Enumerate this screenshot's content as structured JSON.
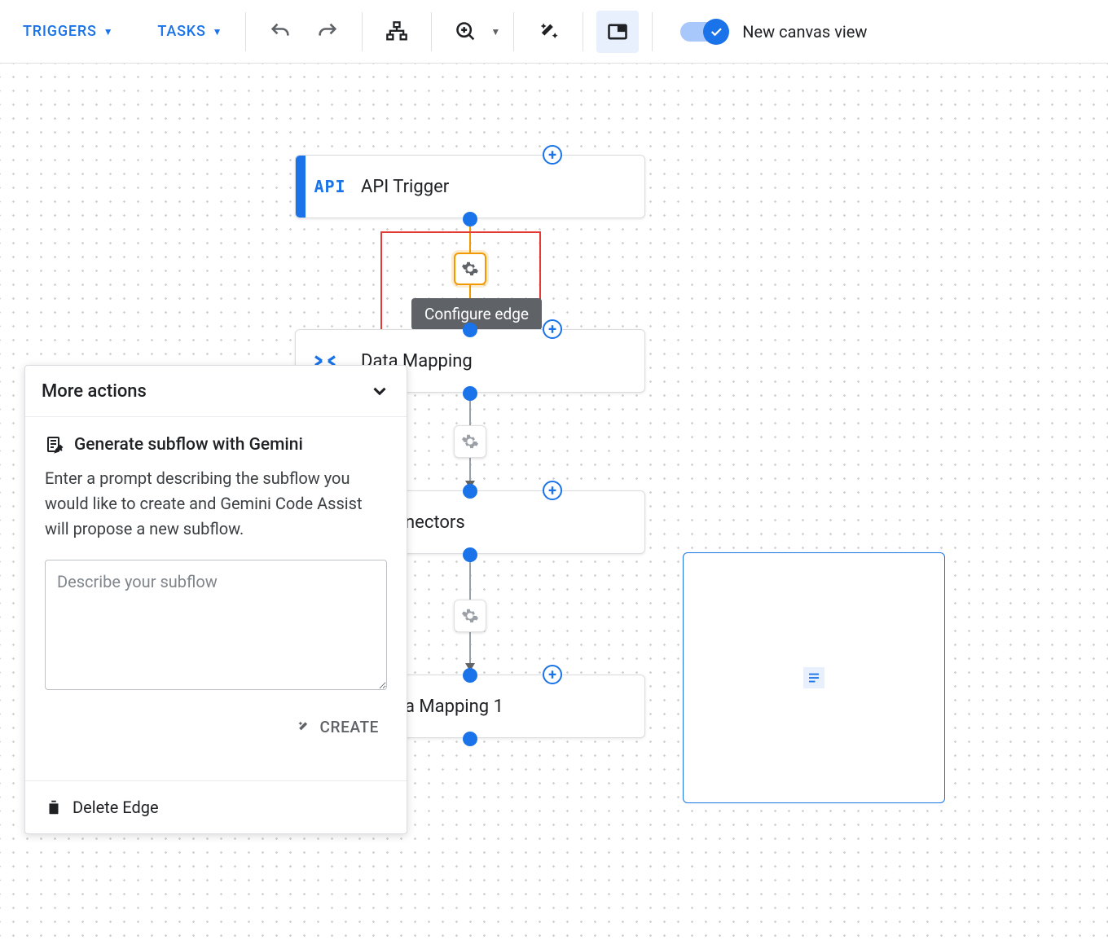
{
  "toolbar": {
    "triggers_label": "TRIGGERS",
    "tasks_label": "TASKS",
    "toggle_label": "New canvas view"
  },
  "nodes": {
    "api_trigger": {
      "label": "API Trigger",
      "icon_text": "API"
    },
    "data_mapping": {
      "label": "Data Mapping"
    },
    "connectors": {
      "label": "nectors"
    },
    "data_mapping_1": {
      "label": "a Mapping 1"
    }
  },
  "tooltip": {
    "configure_edge": "Configure edge"
  },
  "panel": {
    "title": "More actions",
    "gen_title": "Generate subflow with Gemini",
    "gen_desc": "Enter a prompt describing the subflow you would like to create and Gemini Code Assist will propose a new subflow.",
    "placeholder": "Describe your subflow",
    "create_label": "CREATE",
    "delete_label": "Delete Edge"
  }
}
